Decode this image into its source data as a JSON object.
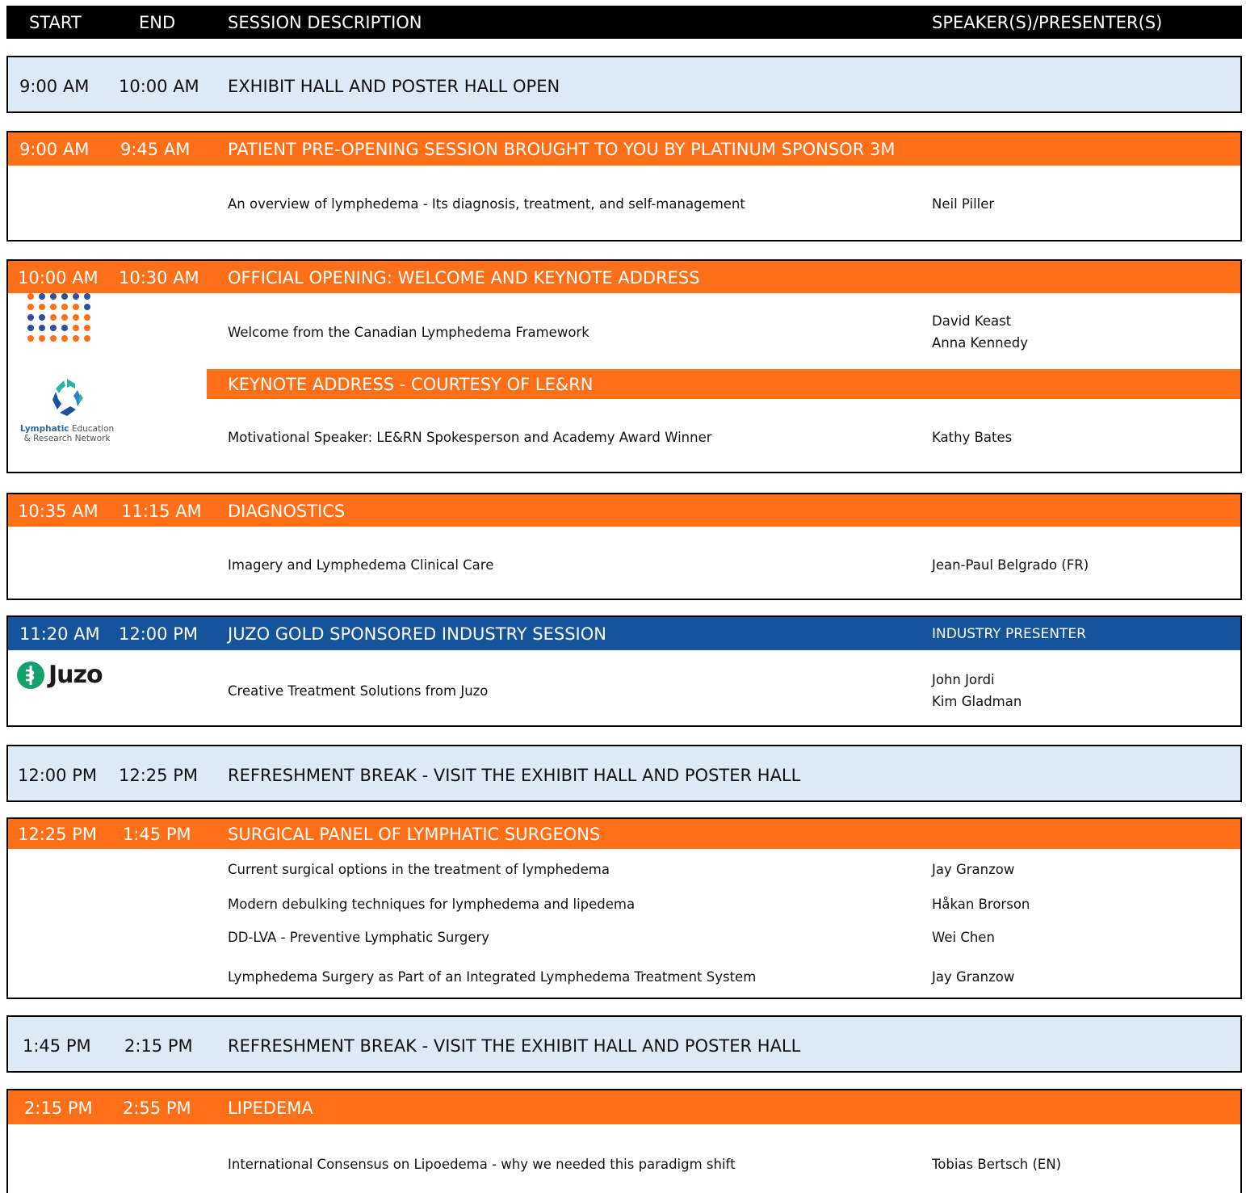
{
  "header": {
    "start": "START",
    "end": "END",
    "description": "SESSION DESCRIPTION",
    "speakers": "SPEAKER(S)/PRESENTER(S)"
  },
  "b1": {
    "start": "9:00 AM",
    "end": "10:00 AM",
    "title": "EXHIBIT HALL AND POSTER HALL OPEN"
  },
  "b2": {
    "start": "9:00 AM",
    "end": "9:45 AM",
    "title": "PATIENT PRE-OPENING SESSION BROUGHT TO YOU BY PLATINUM SPONSOR 3M",
    "items": [
      {
        "desc": "An overview of lymphedema - Its diagnosis, treatment, and self-management",
        "speaker": "Neil Piller"
      }
    ]
  },
  "b3": {
    "start": "10:00 AM",
    "end": "10:30 AM",
    "title": "OFFICIAL OPENING: WELCOME AND KEYNOTE ADDRESS",
    "items": [
      {
        "desc": "Welcome from the Canadian Lymphedema Framework",
        "speaker1": "David Keast",
        "speaker2": "Anna Kennedy"
      },
      {
        "desc": "Motivational Speaker: LE&RN Spokesperson and Academy Award Winner",
        "speaker": "Kathy Bates"
      }
    ],
    "keynote": "KEYNOTE ADDRESS - COURTESY OF LE&RN",
    "lern_logo": {
      "name1": "Lymphatic",
      "name2": "Education",
      "name3": "& Research Network"
    }
  },
  "b4": {
    "start": "10:35 AM",
    "end": "11:15 AM",
    "title": "DIAGNOSTICS",
    "items": [
      {
        "desc": "Imagery and Lymphedema Clinical Care",
        "speaker": "Jean-Paul Belgrado (FR)"
      }
    ]
  },
  "b5": {
    "start": "11:20 AM",
    "end": "12:00 PM",
    "title": "JUZO GOLD SPONSORED INDUSTRY SESSION",
    "presenter_label": "INDUSTRY PRESENTER",
    "items": [
      {
        "desc": "Creative Treatment Solutions from Juzo",
        "speaker1": "John Jordi",
        "speaker2": "Kim Gladman"
      }
    ],
    "logo_text": "Juzo"
  },
  "b6": {
    "start": "12:00 PM",
    "end": "12:25 PM",
    "title": "REFRESHMENT BREAK - VISIT THE EXHIBIT HALL AND POSTER HALL"
  },
  "b7": {
    "start": "12:25 PM",
    "end": "1:45 PM",
    "title": "SURGICAL PANEL OF LYMPHATIC SURGEONS",
    "items": [
      {
        "desc": "Current surgical options in the treatment of lymphedema",
        "speaker": "Jay Granzow"
      },
      {
        "desc": "Modern debulking techniques for lymphedema and lipedema",
        "speaker": "Håkan Brorson"
      },
      {
        "desc": "DD-LVA - Preventive Lymphatic Surgery",
        "speaker": "Wei Chen"
      },
      {
        "desc": "Lymphedema Surgery as Part of an Integrated Lymphedema Treatment System",
        "speaker": "Jay Granzow"
      }
    ]
  },
  "b8": {
    "start": "1:45 PM",
    "end": "2:15 PM",
    "title": "REFRESHMENT BREAK - VISIT THE EXHIBIT HALL AND POSTER HALL"
  },
  "b9": {
    "start": "2:15 PM",
    "end": "2:55 PM",
    "title": "LIPEDEMA",
    "items": [
      {
        "desc": "International Consensus on Lipoedema - why we needed this paradigm shift",
        "speaker": "Tobias Bertsch (EN)"
      }
    ]
  },
  "colors": {
    "orange": "#ff6f17",
    "blue": "#15549a",
    "light": "#dde9f4",
    "black": "#000000"
  }
}
